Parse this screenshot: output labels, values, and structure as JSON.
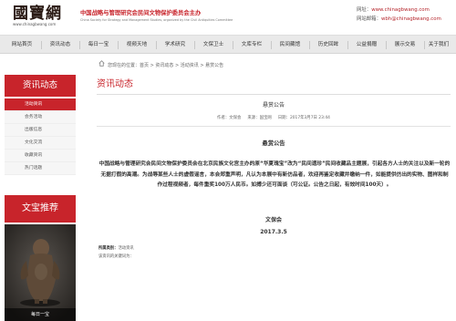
{
  "header": {
    "logo_text": "國寶網",
    "logo_url": "www.chinagbwang.com",
    "org_cn": "中国战略与管理研究会民间文物保护委员会主办",
    "org_en": "China Society for Strategy and Management Studies, organized by the Civil Antiquities Committee",
    "site_label": "网址：",
    "site_url": "www.chinagbwang.com",
    "email_label": "网站邮箱：",
    "email": "wbh@chinagbwang.com"
  },
  "nav": {
    "items": [
      "网站首页",
      "资讯动态",
      "每日一宝",
      "视频天地",
      "学术研究",
      "文保卫士",
      "文库专栏",
      "民间藏馆",
      "历史回眸",
      "公益捐赠",
      "展示交易",
      "关于我们"
    ]
  },
  "breadcrumb": {
    "text": "您现在的位置：首页 > 资讯动态 > 活动资讯 > 悬赏公告"
  },
  "sidebar": {
    "section_title": "资讯动态",
    "items": [
      "活动资讯",
      "会务活动",
      "出版信息",
      "文化交流",
      "收藏资讯",
      "热门话题"
    ],
    "treasure_title": "文宝推荐",
    "treasure_caption": "每日一宝"
  },
  "article": {
    "section_title": "资讯动态",
    "title": "悬赏公告",
    "meta_author_label": "作者：",
    "meta_author": "文保会",
    "meta_source_label": "来源：",
    "meta_source": "国宝网",
    "meta_date_label": "日期：",
    "meta_date": "2017年3月7日 23:44",
    "content_title": "悬赏公告",
    "body": "中国战略与管理研究会民间文物保护委员会在北京民族文化宫主办的原“华夏瑰宝”改为“民间遗珍”民间收藏品主题展，引起各方人士的关注以及新一轮的无据打假的高潮。为战辱某些人士的虚假谣言，本会郑重声明，凡认为本展中有新仿品者，欢迎再鉴定收藏并缴纳一件，如能提供仿出的实物、图样和制作过程视频者，每件重奖100万人民币。如搏少还可面谈（可公证。公告之日起，有效时间100天）。",
    "signer": "文保会",
    "sign_date": "2017.3.5",
    "related_label": "所属类别：",
    "related_value": "活动资讯",
    "keywords_label": "该资讯的关键词为："
  }
}
